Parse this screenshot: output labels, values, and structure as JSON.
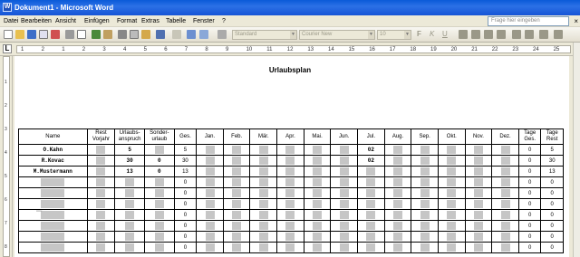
{
  "window": {
    "title": "Dokument1 - Microsoft Word",
    "app_icon": "W"
  },
  "menu": {
    "items": [
      "Datei",
      "Bearbeiten",
      "Ansicht",
      "Einfügen",
      "Format",
      "Extras",
      "Tabelle",
      "Fenster",
      "?"
    ],
    "help_placeholder": "Frage hier eingeben",
    "close_glyph": "×"
  },
  "toolbar": {
    "style": "Standard",
    "font": "Courier New",
    "size": "10",
    "bold": "F",
    "italic": "K",
    "underline": "U"
  },
  "ruler": {
    "labels": [
      "1",
      "2",
      "1",
      "2",
      "3",
      "4",
      "5",
      "6",
      "7",
      "8",
      "9",
      "10",
      "11",
      "12",
      "13",
      "14",
      "15",
      "16",
      "17",
      "18",
      "19",
      "20",
      "21",
      "22",
      "23",
      "24",
      "25"
    ]
  },
  "vruler": {
    "labels": [
      "1",
      "2",
      "3",
      "4",
      "5",
      "6",
      "7",
      "8"
    ]
  },
  "doc": {
    "title": "Urlaubsplan"
  },
  "table": {
    "headers": [
      "Name",
      "Rest Vorjahr",
      "Urlaubs-anspruch",
      "Sonder-urlaub",
      "Ges.",
      "Jan.",
      "Feb.",
      "Mär.",
      "Apr.",
      "Mai.",
      "Jun.",
      "Jul.",
      "Aug.",
      "Sep.",
      "Okt.",
      "Nov.",
      "Dez.",
      "Tage Ges.",
      "Tage Rest"
    ],
    "rows": [
      {
        "name": "O.Kahn",
        "rest": "",
        "anspruch": "5",
        "sonder": "",
        "ges": "5",
        "months": [
          "",
          "",
          "",
          "",
          "",
          "",
          "02",
          "",
          "",
          "",
          "",
          ""
        ],
        "tage_ges": "0",
        "tage_rest": "5"
      },
      {
        "name": "R.Kovac",
        "rest": "",
        "anspruch": "30",
        "sonder": "0",
        "ges": "30",
        "months": [
          "",
          "",
          "",
          "",
          "",
          "",
          "02",
          "",
          "",
          "",
          "",
          ""
        ],
        "tage_ges": "0",
        "tage_rest": "30"
      },
      {
        "name": "M.Mustermann",
        "rest": "",
        "anspruch": "13",
        "sonder": "0",
        "ges": "13",
        "months": [
          "",
          "",
          "",
          "",
          "",
          "",
          "",
          "",
          "",
          "",
          "",
          ""
        ],
        "tage_ges": "0",
        "tage_rest": "13"
      },
      {
        "name": "",
        "rest": "",
        "anspruch": "",
        "sonder": "",
        "ges": "0",
        "months": [
          "",
          "",
          "",
          "",
          "",
          "",
          "",
          "",
          "",
          "",
          "",
          ""
        ],
        "tage_ges": "0",
        "tage_rest": "0"
      },
      {
        "name": "",
        "rest": "",
        "anspruch": "",
        "sonder": "",
        "ges": "0",
        "months": [
          "",
          "",
          "",
          "",
          "",
          "",
          "",
          "",
          "",
          "",
          "",
          ""
        ],
        "tage_ges": "0",
        "tage_rest": "0"
      },
      {
        "name": "",
        "rest": "",
        "anspruch": "",
        "sonder": "",
        "ges": "0",
        "months": [
          "",
          "",
          "",
          "",
          "",
          "",
          "",
          "",
          "",
          "",
          "",
          ""
        ],
        "tage_ges": "0",
        "tage_rest": "0"
      },
      {
        "name": "",
        "rest": "",
        "anspruch": "",
        "sonder": "",
        "ges": "0",
        "months": [
          "",
          "",
          "",
          "",
          "",
          "",
          "",
          "",
          "",
          "",
          "",
          ""
        ],
        "tage_ges": "0",
        "tage_rest": "0"
      },
      {
        "name": "",
        "rest": "",
        "anspruch": "",
        "sonder": "",
        "ges": "0",
        "months": [
          "",
          "",
          "",
          "",
          "",
          "",
          "",
          "",
          "",
          "",
          "",
          ""
        ],
        "tage_ges": "0",
        "tage_rest": "0"
      },
      {
        "name": "",
        "rest": "",
        "anspruch": "",
        "sonder": "",
        "ges": "0",
        "months": [
          "",
          "",
          "",
          "",
          "",
          "",
          "",
          "",
          "",
          "",
          "",
          ""
        ],
        "tage_ges": "0",
        "tage_rest": "0"
      },
      {
        "name": "",
        "rest": "",
        "anspruch": "",
        "sonder": "",
        "ges": "0",
        "months": [
          "",
          "",
          "",
          "",
          "",
          "",
          "",
          "",
          "",
          "",
          "",
          ""
        ],
        "tage_ges": "0",
        "tage_rest": "0"
      }
    ]
  },
  "colors": {
    "titlebar": "#0a5ad8",
    "shade": "#c6c6c6"
  }
}
